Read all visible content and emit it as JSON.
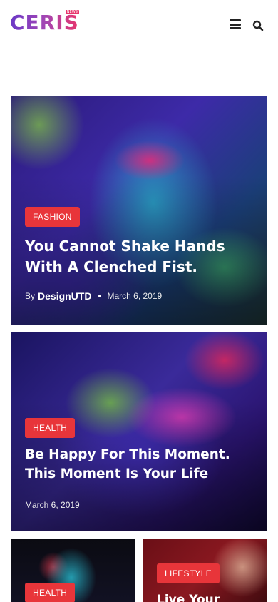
{
  "header": {
    "logo_text": "CERIS",
    "logo_tag": "NEWS",
    "menu_icon": "hamburger-menu-icon",
    "search_icon": "search-icon"
  },
  "colors": {
    "accent": "#e8353a",
    "logo_gradient_start": "#6a38c7",
    "logo_gradient_end": "#e8356c"
  },
  "posts": [
    {
      "category": "FASHION",
      "title": "You Cannot Shake Hands With A Clenched Fist.",
      "by_label": "By",
      "author": "DesignUTD",
      "date": "March 6, 2019"
    },
    {
      "category": "HEALTH",
      "title": "Be Happy For This Moment. This Moment Is Your Life",
      "date": "March 6, 2019"
    },
    {
      "category": "HEALTH"
    },
    {
      "category": "LIFESTYLE",
      "title": "Live Your"
    }
  ]
}
